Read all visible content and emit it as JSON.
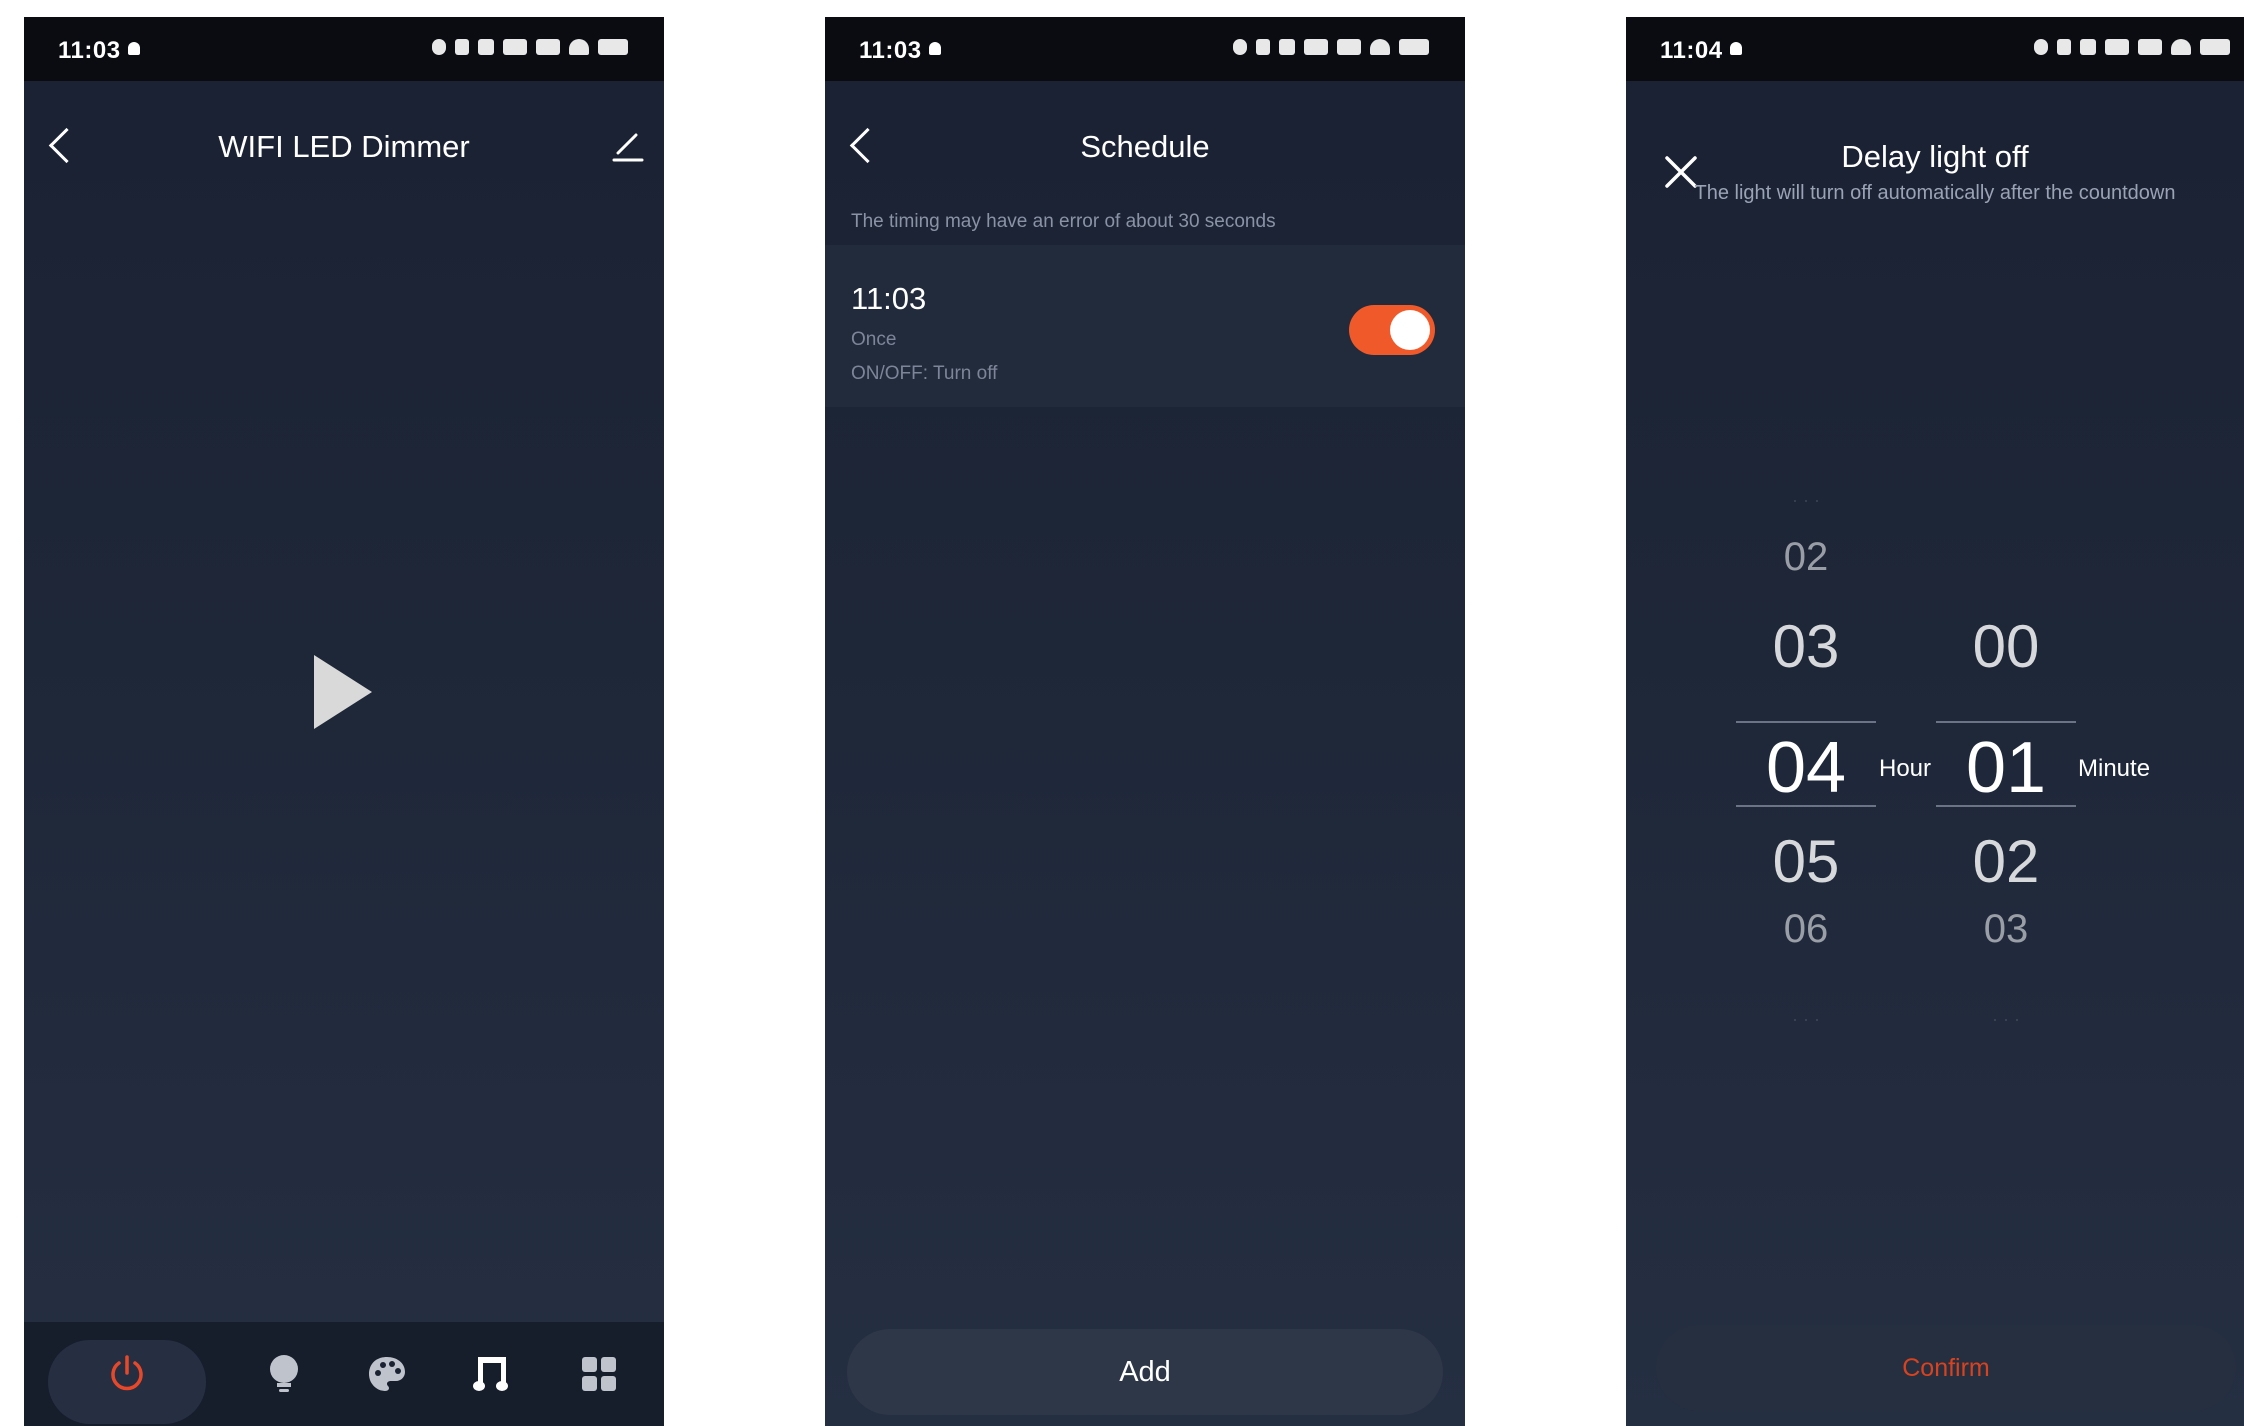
{
  "screens": [
    {
      "status": {
        "time": "11:03"
      },
      "header": {
        "title": "WIFI LED Dimmer"
      },
      "nav": {
        "items": [
          "power-icon",
          "bulb-icon",
          "palette-icon",
          "music-icon",
          "grid-icon"
        ],
        "active_color": "#e8482a"
      }
    },
    {
      "status": {
        "time": "11:03"
      },
      "header": {
        "title": "Schedule"
      },
      "hint": "The timing may have an error of about 30 seconds",
      "schedules": [
        {
          "time": "11:03",
          "repeat": "Once",
          "action": "ON/OFF: Turn off",
          "enabled": true
        }
      ],
      "add_label": "Add",
      "accent": "#f05a2a"
    },
    {
      "status": {
        "time": "11:04"
      },
      "dialog": {
        "title": "Delay light off",
        "subtitle": "The light will turn off automatically after the countdown"
      },
      "picker": {
        "hour": {
          "above": [
            "02",
            "03"
          ],
          "selected": "04",
          "below": [
            "05",
            "06"
          ],
          "unit": "Hour"
        },
        "minute": {
          "above": [
            "00"
          ],
          "selected": "01",
          "below": [
            "02",
            "03"
          ],
          "unit": "Minute"
        }
      },
      "confirm_label": "Confirm",
      "confirm_color": "#d8421e"
    }
  ]
}
